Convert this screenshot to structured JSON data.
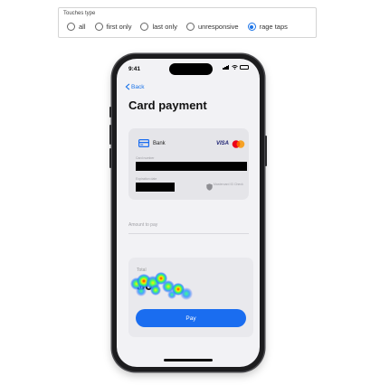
{
  "filter": {
    "legend": "Touches type",
    "options": [
      {
        "label": "all",
        "selected": false
      },
      {
        "label": "first only",
        "selected": false
      },
      {
        "label": "last only",
        "selected": false
      },
      {
        "label": "unresponsive",
        "selected": false
      },
      {
        "label": "rage taps",
        "selected": true
      }
    ]
  },
  "status_bar": {
    "time": "9:41",
    "icons": [
      "signal-icon",
      "wifi-icon",
      "battery-icon"
    ]
  },
  "nav": {
    "back_label": "Back"
  },
  "page": {
    "title": "Card payment"
  },
  "card": {
    "bank_name": "Bank",
    "brand_text": "VISA",
    "card_number_label": "Card number",
    "expiry_label": "Expiration date",
    "id_check_text": "Mastercard ID Check"
  },
  "amount": {
    "label": "Amount to pay"
  },
  "total": {
    "label": "Total",
    "value": "$0"
  },
  "pay": {
    "label": "Pay"
  },
  "colors": {
    "accent": "#1a6df0",
    "selected_radio": "#1a73e8",
    "mastercard_red": "#eb001b",
    "mastercard_orange": "#f79e1b"
  }
}
